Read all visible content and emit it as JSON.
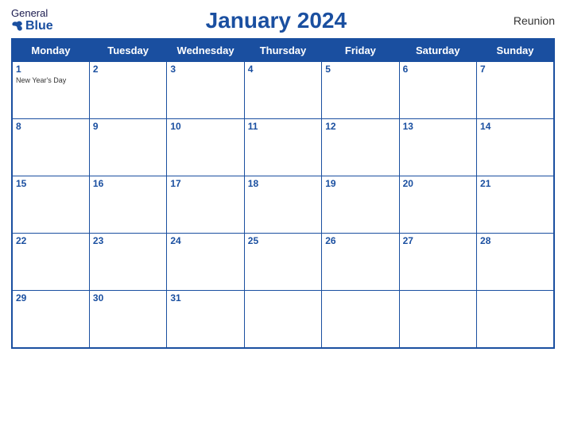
{
  "logo": {
    "general": "General",
    "blue": "Blue"
  },
  "title": "January 2024",
  "region": "Reunion",
  "days_header": [
    "Monday",
    "Tuesday",
    "Wednesday",
    "Thursday",
    "Friday",
    "Saturday",
    "Sunday"
  ],
  "weeks": [
    [
      {
        "num": "1",
        "holiday": "New Year's Day"
      },
      {
        "num": "2",
        "holiday": ""
      },
      {
        "num": "3",
        "holiday": ""
      },
      {
        "num": "4",
        "holiday": ""
      },
      {
        "num": "5",
        "holiday": ""
      },
      {
        "num": "6",
        "holiday": ""
      },
      {
        "num": "7",
        "holiday": ""
      }
    ],
    [
      {
        "num": "8",
        "holiday": ""
      },
      {
        "num": "9",
        "holiday": ""
      },
      {
        "num": "10",
        "holiday": ""
      },
      {
        "num": "11",
        "holiday": ""
      },
      {
        "num": "12",
        "holiday": ""
      },
      {
        "num": "13",
        "holiday": ""
      },
      {
        "num": "14",
        "holiday": ""
      }
    ],
    [
      {
        "num": "15",
        "holiday": ""
      },
      {
        "num": "16",
        "holiday": ""
      },
      {
        "num": "17",
        "holiday": ""
      },
      {
        "num": "18",
        "holiday": ""
      },
      {
        "num": "19",
        "holiday": ""
      },
      {
        "num": "20",
        "holiday": ""
      },
      {
        "num": "21",
        "holiday": ""
      }
    ],
    [
      {
        "num": "22",
        "holiday": ""
      },
      {
        "num": "23",
        "holiday": ""
      },
      {
        "num": "24",
        "holiday": ""
      },
      {
        "num": "25",
        "holiday": ""
      },
      {
        "num": "26",
        "holiday": ""
      },
      {
        "num": "27",
        "holiday": ""
      },
      {
        "num": "28",
        "holiday": ""
      }
    ],
    [
      {
        "num": "29",
        "holiday": ""
      },
      {
        "num": "30",
        "holiday": ""
      },
      {
        "num": "31",
        "holiday": ""
      },
      {
        "num": "",
        "holiday": ""
      },
      {
        "num": "",
        "holiday": ""
      },
      {
        "num": "",
        "holiday": ""
      },
      {
        "num": "",
        "holiday": ""
      }
    ]
  ]
}
